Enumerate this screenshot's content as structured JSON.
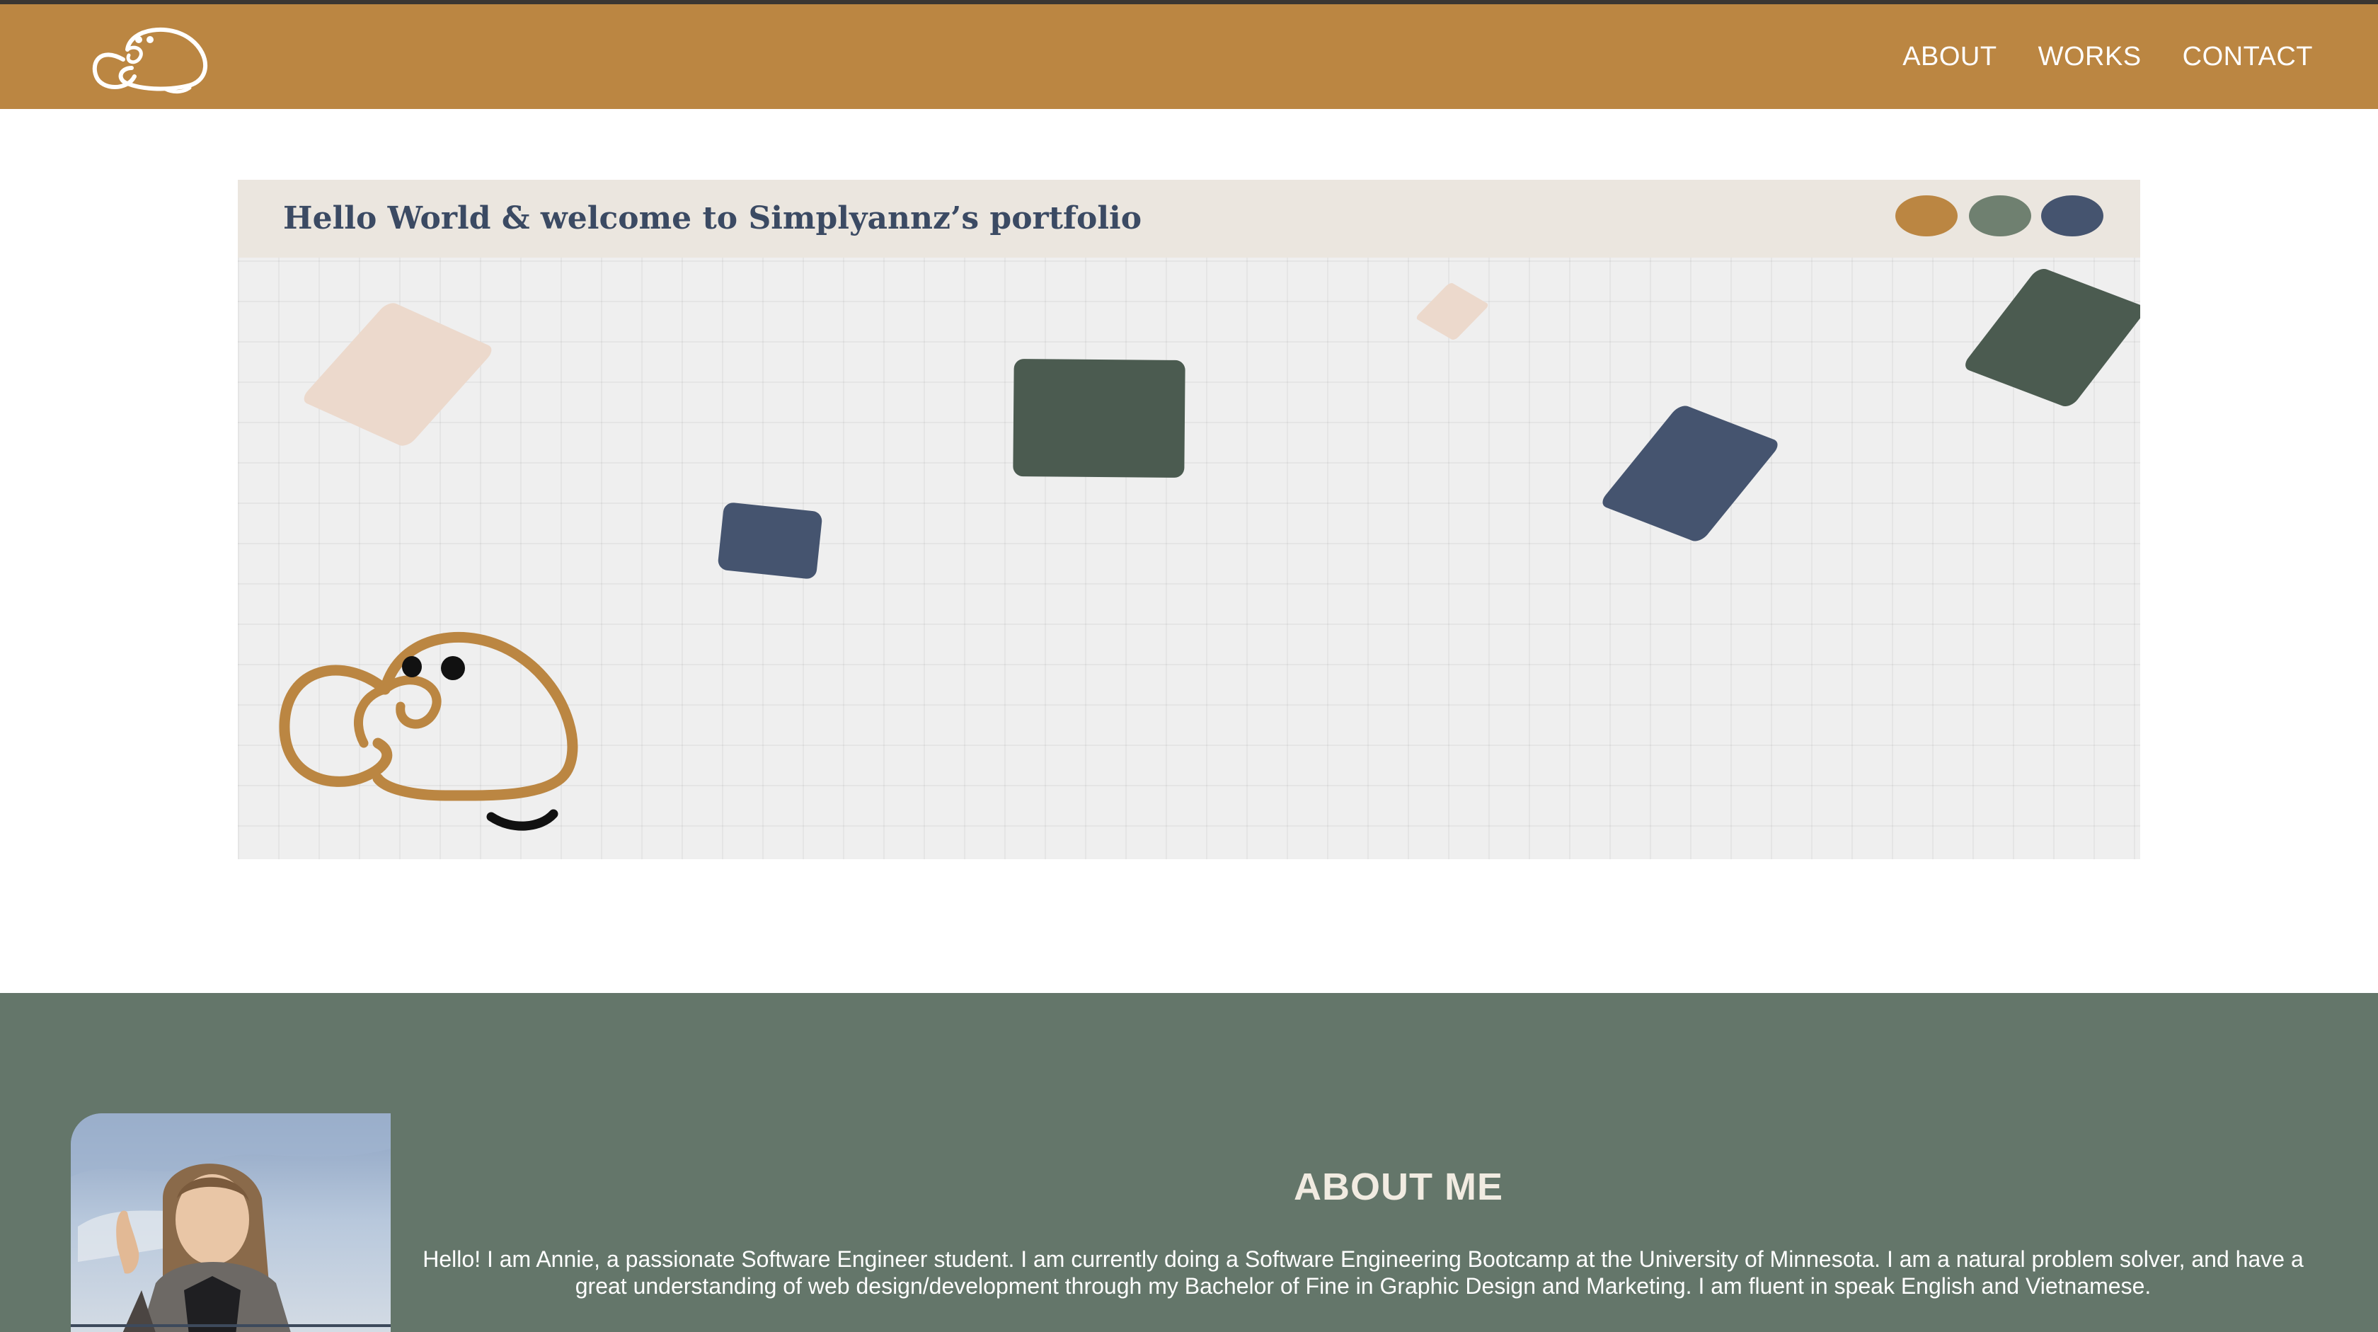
{
  "header": {
    "logo_icon": "mascot-outline-icon",
    "nav": [
      {
        "label": "ABOUT"
      },
      {
        "label": "WORKS"
      },
      {
        "label": "CONTACT"
      }
    ]
  },
  "banner": {
    "title": "Hello World & welcome to Simplyannz’s portfolio",
    "dot_colors": [
      "#bb8642",
      "#6f8070",
      "#45546f"
    ],
    "colors": {
      "peach": "#ecd9cc",
      "green": "#4b5b50",
      "blue": "#45546f",
      "mascot": "#bb8642"
    }
  },
  "about": {
    "title": "ABOUT ME",
    "paragraph": "Hello! I am Annie, a passionate Software Engineer student. I am currently doing a Software Engineering Bootcamp at the University of Minnesota. I am a natural problem solver, and have a great understanding of web design/development through my Bachelor of Fine in Graphic Design and Marketing. I am fluent in speak English and Vietnamese."
  }
}
